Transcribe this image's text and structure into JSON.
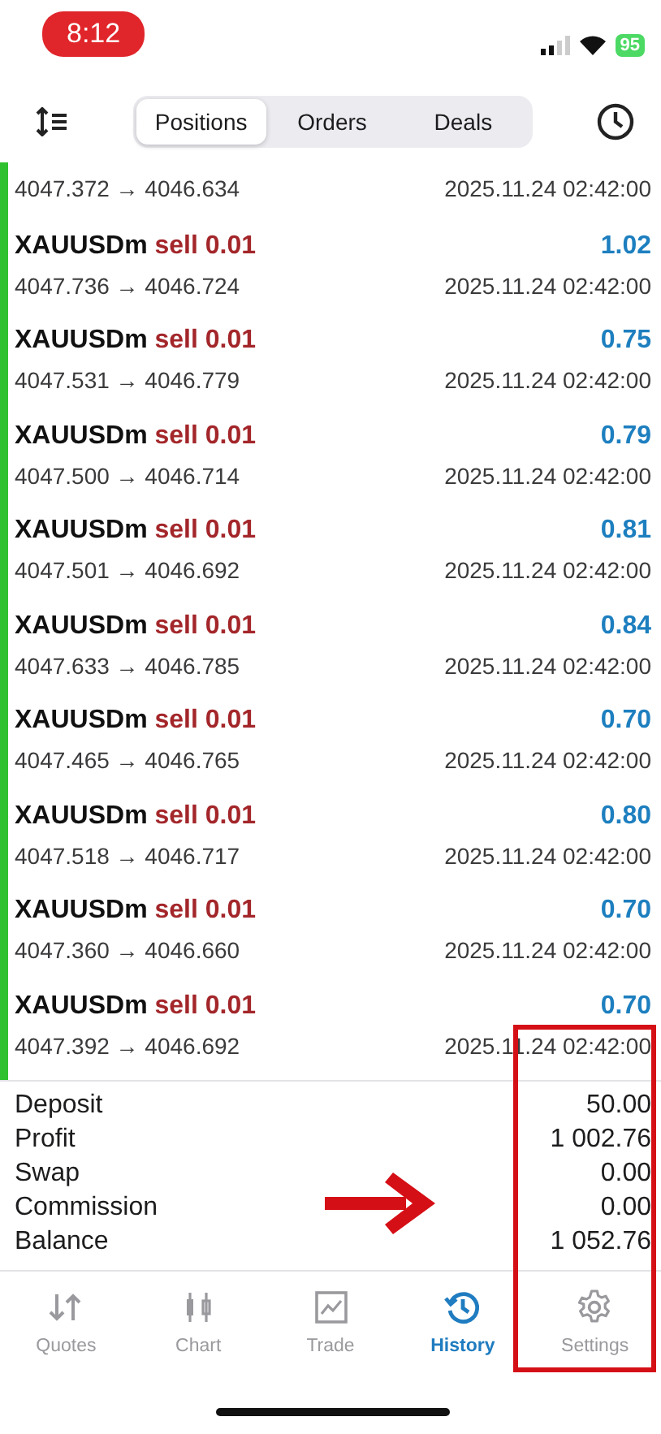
{
  "status_bar": {
    "time": "8:12",
    "battery": "95"
  },
  "toolbar": {
    "tabs": [
      {
        "label": "Positions",
        "selected": true
      },
      {
        "label": "Orders",
        "selected": false
      },
      {
        "label": "Deals",
        "selected": false
      }
    ]
  },
  "partial_row": {
    "prices": "4047.372 → 4046.634",
    "time": "2025.11.24 02:42:00"
  },
  "deals": [
    {
      "symbol": "XAUUSDm",
      "type": "sell",
      "volume": "0.01",
      "profit": "1.02",
      "prices": "4047.736 → 4046.724",
      "time": "2025.11.24 02:42:00"
    },
    {
      "symbol": "XAUUSDm",
      "type": "sell",
      "volume": "0.01",
      "profit": "0.75",
      "prices": "4047.531 → 4046.779",
      "time": "2025.11.24 02:42:00"
    },
    {
      "symbol": "XAUUSDm",
      "type": "sell",
      "volume": "0.01",
      "profit": "0.79",
      "prices": "4047.500 → 4046.714",
      "time": "2025.11.24 02:42:00"
    },
    {
      "symbol": "XAUUSDm",
      "type": "sell",
      "volume": "0.01",
      "profit": "0.81",
      "prices": "4047.501 → 4046.692",
      "time": "2025.11.24 02:42:00"
    },
    {
      "symbol": "XAUUSDm",
      "type": "sell",
      "volume": "0.01",
      "profit": "0.84",
      "prices": "4047.633 → 4046.785",
      "time": "2025.11.24 02:42:00"
    },
    {
      "symbol": "XAUUSDm",
      "type": "sell",
      "volume": "0.01",
      "profit": "0.70",
      "prices": "4047.465 → 4046.765",
      "time": "2025.11.24 02:42:00"
    },
    {
      "symbol": "XAUUSDm",
      "type": "sell",
      "volume": "0.01",
      "profit": "0.80",
      "prices": "4047.518 → 4046.717",
      "time": "2025.11.24 02:42:00"
    },
    {
      "symbol": "XAUUSDm",
      "type": "sell",
      "volume": "0.01",
      "profit": "0.70",
      "prices": "4047.360 → 4046.660",
      "time": "2025.11.24 02:42:00"
    },
    {
      "symbol": "XAUUSDm",
      "type": "sell",
      "volume": "0.01",
      "profit": "0.70",
      "prices": "4047.392 → 4046.692",
      "time": "2025.11.24 02:42:00"
    }
  ],
  "summary": [
    {
      "label": "Deposit",
      "value": "50.00"
    },
    {
      "label": "Profit",
      "value": "1 002.76"
    },
    {
      "label": "Swap",
      "value": "0.00"
    },
    {
      "label": "Commission",
      "value": "0.00"
    },
    {
      "label": "Balance",
      "value": "1 052.76"
    }
  ],
  "tab_bar": [
    {
      "kind": "quotes",
      "label": "Quotes",
      "selected": false
    },
    {
      "kind": "chart",
      "label": "Chart",
      "selected": false
    },
    {
      "kind": "trade",
      "label": "Trade",
      "selected": false
    },
    {
      "kind": "history",
      "label": "History",
      "selected": true
    },
    {
      "kind": "settings",
      "label": "Settings",
      "selected": false
    }
  ]
}
